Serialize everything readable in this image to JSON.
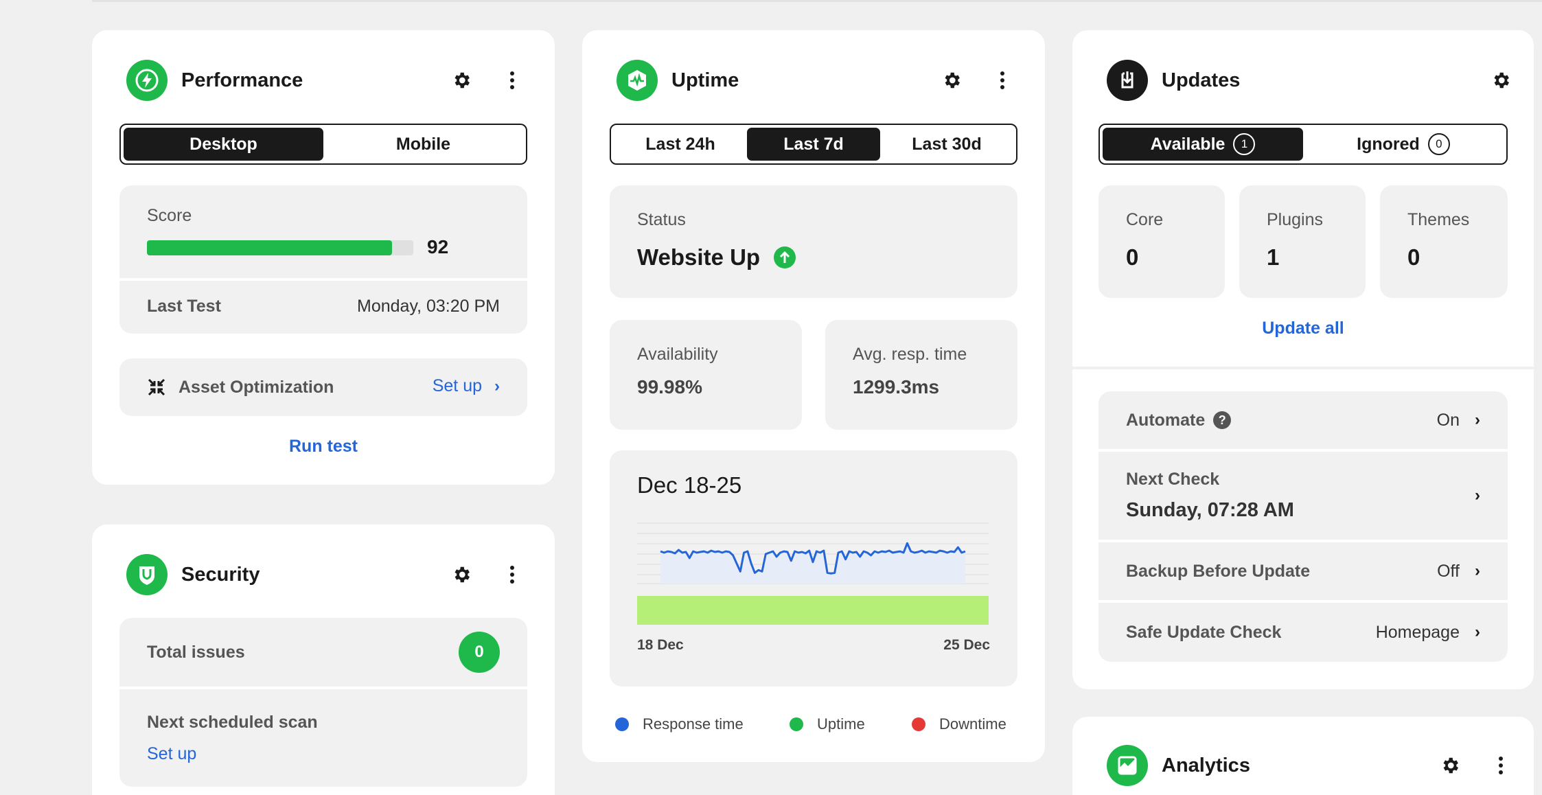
{
  "performance": {
    "title": "Performance",
    "tabs": [
      "Desktop",
      "Mobile"
    ],
    "active_tab": 0,
    "score_label": "Score",
    "score": "92",
    "score_fraction": 0.92,
    "last_test_label": "Last Test",
    "last_test_value": "Monday, 03:20 PM",
    "asset_label": "Asset Optimization",
    "asset_action": "Set up",
    "run_test": "Run test",
    "accent": "#1fb84a"
  },
  "security": {
    "title": "Security",
    "total_issues_label": "Total issues",
    "total_issues": "0",
    "next_scan_label": "Next scheduled scan",
    "next_scan_action": "Set up"
  },
  "uptime": {
    "title": "Uptime",
    "tabs": [
      "Last 24h",
      "Last 7d",
      "Last 30d"
    ],
    "active_tab": 1,
    "status_label": "Status",
    "status_value": "Website Up",
    "availability_label": "Availability",
    "availability_value": "99.98%",
    "resp_label": "Avg. resp. time",
    "resp_value": "1299.3ms",
    "range_title": "Dec 18-25",
    "x_start": "18 Dec",
    "x_end": "25 Dec",
    "legend": [
      "Response time",
      "Uptime",
      "Downtime"
    ],
    "legend_colors": [
      "#2466d8",
      "#1fb84a",
      "#e53935"
    ]
  },
  "chart_data": {
    "type": "line",
    "title": "Dec 18-25",
    "xlabel": "",
    "ylabel": "",
    "x_ticks": [
      "18 Dec",
      "25 Dec"
    ],
    "series": [
      {
        "name": "Response time",
        "values": [
          42,
          44,
          42,
          43,
          45,
          40,
          44,
          43,
          52,
          42,
          44,
          43,
          42,
          44,
          41,
          43,
          42,
          44,
          42,
          43,
          48,
          60,
          72,
          44,
          42,
          60,
          74,
          70,
          72,
          46,
          44,
          42,
          50,
          44,
          42,
          43,
          56,
          42,
          44,
          43,
          45,
          41,
          58,
          42,
          44,
          41,
          74,
          75,
          74,
          44,
          42,
          54,
          42,
          44,
          43,
          50,
          42,
          44,
          48,
          42,
          44,
          42,
          43,
          41,
          44,
          43,
          42,
          44,
          30,
          42,
          44,
          43,
          41,
          44,
          42,
          43,
          44,
          41,
          42,
          44,
          42,
          43,
          36,
          44,
          42
        ]
      },
      {
        "name": "Uptime",
        "values": [
          100,
          100,
          100,
          100,
          100,
          100,
          100,
          100
        ]
      }
    ]
  },
  "updates": {
    "title": "Updates",
    "tabs": [
      {
        "label": "Available",
        "count": "1"
      },
      {
        "label": "Ignored",
        "count": "0"
      }
    ],
    "active_tab": 0,
    "core_label": "Core",
    "core_value": "0",
    "plugins_label": "Plugins",
    "plugins_value": "1",
    "themes_label": "Themes",
    "themes_value": "0",
    "update_all": "Update all",
    "automate_label": "Automate",
    "automate_help": "?",
    "automate_value": "On",
    "next_check_label": "Next Check",
    "next_check_value": "Sunday, 07:28 AM",
    "backup_label": "Backup Before Update",
    "backup_value": "Off",
    "safe_label": "Safe Update Check",
    "safe_value": "Homepage"
  },
  "analytics": {
    "title": "Analytics"
  }
}
